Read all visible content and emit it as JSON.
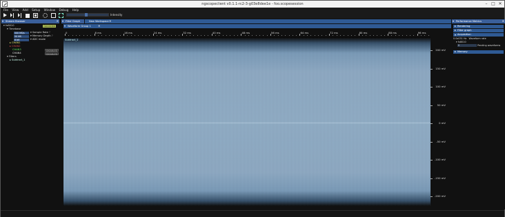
{
  "window": {
    "title": "ngscopeclient v0.1.1-rc2-3-g03e8dee1e - foo.scopesession",
    "min": "–",
    "max": "□",
    "close": "✕"
  },
  "menu": [
    "File",
    "View",
    "Add",
    "Setup",
    "Window",
    "Debug",
    "Help"
  ],
  "toolbar": {
    "intensity_label": "Intensity",
    "intensity_value": 0.45
  },
  "stream_browser": {
    "title": "Stream Browser",
    "tree": {
      "device": "fx8010",
      "device_badge": "Connected",
      "timebase": "Timebase",
      "sample_rate_value": "500 MS/s",
      "sample_rate_label": "Sample Rate",
      "memory_depth_value": "50 MS",
      "memory_depth_label": "Memory Depth",
      "adc_value": "8 bit",
      "adc_label": "ADC mode",
      "ch1": "CHAN1",
      "ch2": "CHAN2",
      "ch3": "CHAN3",
      "ch4": "CHAN4",
      "ch3_badge": "DISABLED",
      "ch4_badge": "DISABLED",
      "filters": "Filters",
      "filter1": "Subtract_1",
      "sample_rate_icon": "?",
      "memory_depth_icon": "?"
    }
  },
  "center": {
    "tab_filter_graph": "Filter Graph",
    "tab_new_workspace": "New Workspace",
    "waveform_group": "Waveform Group 1",
    "trace_label": "Subtract_1",
    "time_ticks": [
      "0",
      "8 ms",
      "16 ms",
      "24 ms",
      "32 ms",
      "40 ms",
      "48 ms",
      "56 ms",
      "64 ms",
      "72 ms",
      "80 ms",
      "88 ms",
      "96 ms"
    ],
    "y_ticks": [
      "200 mV",
      "150 mV",
      "100 mV",
      "50 mV",
      "0 mV",
      "-50 mV",
      "-100 mV",
      "-150 mV",
      "-200 mV"
    ]
  },
  "perf": {
    "title": "Performance Metrics",
    "sections": [
      "Rendering",
      "Filter graph",
      "Acquisition",
      "Memory"
    ],
    "acq_rate_value": "0.0x031 Hz",
    "acq_rate_label": "Waveform rate",
    "instrument": "fx8010",
    "pending_value": "0",
    "pending_label": "Pending waveforms"
  },
  "colors": {
    "accent": "#3a5f9a",
    "waveform": "#8eaac4",
    "connected_badge": "#b7c85a",
    "chan1": "#e8e877",
    "chan2": "#d04848",
    "chan3": "#58e058",
    "chan4": "#e8e8e8"
  }
}
